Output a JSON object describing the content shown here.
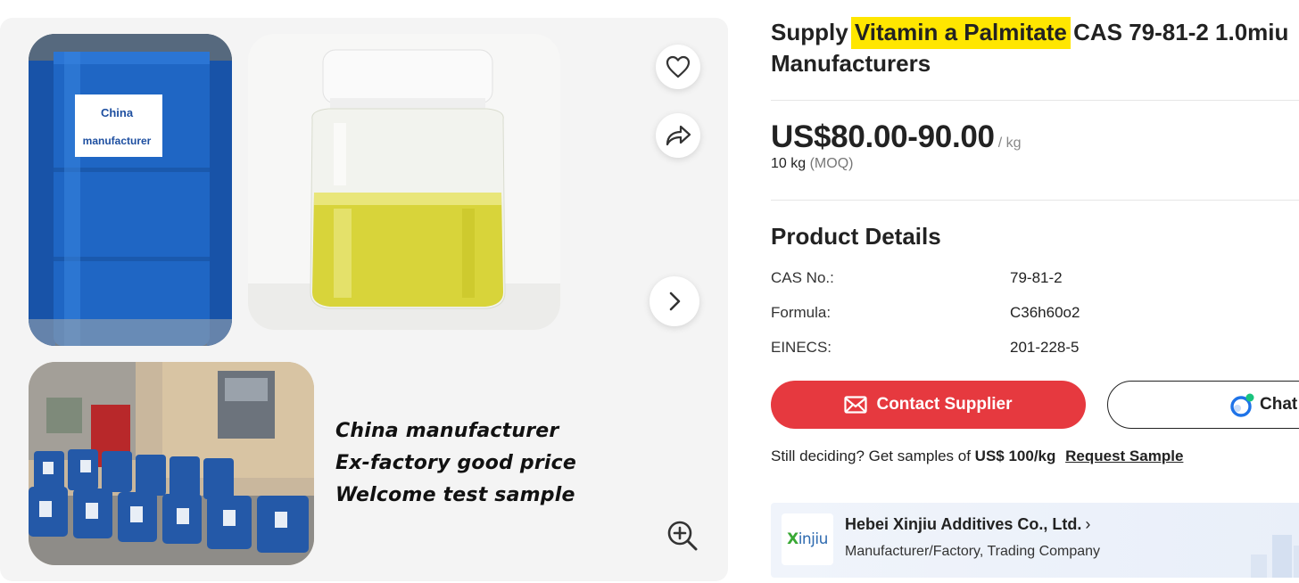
{
  "product": {
    "title_before": "Supply ",
    "title_highlight": "Vitamin a Palmitate",
    "title_after": " CAS 79-81-2 1.0miu",
    "title_line2": "Manufacturers",
    "price": "US$80.00-90.00",
    "price_unit": "/ kg",
    "moq_value": "10 kg",
    "moq_label": "(MOQ)"
  },
  "gallery": {
    "drum_label_line1": "China",
    "drum_label_line2": "manufacturer",
    "slogans": [
      "China  manufacturer",
      "Ex-factory good price",
      "Welcome test sample"
    ],
    "icons": [
      "heart-icon",
      "share-icon",
      "chevron-right-icon",
      "zoom-in-icon"
    ]
  },
  "details": {
    "heading": "Product Details",
    "rows": [
      {
        "key": "CAS No.:",
        "value": "79-81-2"
      },
      {
        "key": "Formula:",
        "value": "C36h60o2"
      },
      {
        "key": "EINECS:",
        "value": "201-228-5"
      }
    ]
  },
  "actions": {
    "contact_label": "Contact Supplier",
    "chat_label": "Chat"
  },
  "sample": {
    "text": "Still deciding? Get samples of ",
    "price": "US$ 100/kg",
    "link": "Request Sample"
  },
  "supplier": {
    "logo_x": "X",
    "logo_rest": "injiu",
    "name": "Hebei Xinjiu Additives Co., Ltd.",
    "chevron": "›",
    "type": "Manufacturer/Factory, Trading Company"
  },
  "colors": {
    "primary_red": "#e6393f",
    "highlight_yellow": "#ffe600",
    "drum_blue": "#1f66c4",
    "oil_yellow": "#d8d43a"
  }
}
